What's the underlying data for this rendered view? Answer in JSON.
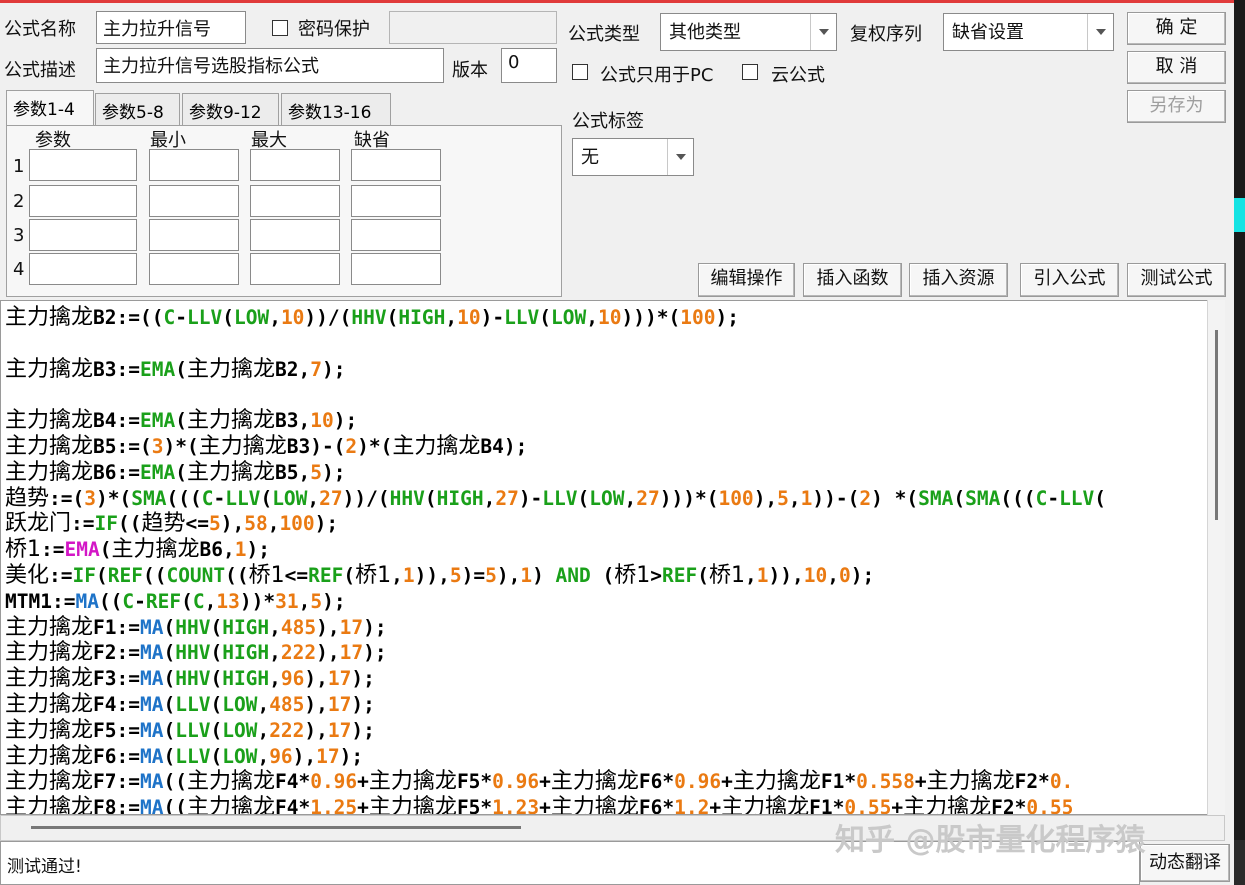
{
  "form": {
    "name_label": "公式名称",
    "name_value": "主力拉升信号",
    "password_label": "密码保护",
    "desc_label": "公式描述",
    "desc_value": "主力拉升信号选股指标公式",
    "version_label": "版本",
    "version_value": "0",
    "type_label": "公式类型",
    "type_value": "其他类型",
    "rights_label": "复权序列",
    "rights_value": "缺省设置",
    "pc_only_label": "公式只用于PC",
    "cloud_label": "云公式",
    "tag_label": "公式标签",
    "tag_value": "无"
  },
  "buttons": {
    "ok": "确 定",
    "cancel": "取 消",
    "save_as": "另存为",
    "edit": "编辑操作",
    "insert_func": "插入函数",
    "insert_res": "插入资源",
    "import": "引入公式",
    "test": "测试公式",
    "translate": "动态翻译"
  },
  "params": {
    "tabs": [
      "参数1-4",
      "参数5-8",
      "参数9-12",
      "参数13-16"
    ],
    "headers": [
      "参数",
      "最小",
      "最大",
      "缺省"
    ],
    "rows": [
      "1",
      "2",
      "3",
      "4"
    ]
  },
  "status": "测试通过!",
  "watermark": "知乎 @股市量化程序猿",
  "colors": {
    "function_green": "#1aa01a",
    "function_blue": "#1e73c8",
    "function_magenta": "#d316c6",
    "number_orange": "#ea7a12"
  },
  "code_lines": [
    [
      [
        "c",
        "主力擒龙"
      ],
      [
        "t",
        "B2:=(("
      ],
      [
        "f",
        "C"
      ],
      [
        "t",
        "-"
      ],
      [
        "f",
        "LLV"
      ],
      [
        "t",
        "("
      ],
      [
        "f",
        "LOW"
      ],
      [
        "t",
        ","
      ],
      [
        "n",
        "10"
      ],
      [
        "t",
        "))/("
      ],
      [
        "f",
        "HHV"
      ],
      [
        "t",
        "("
      ],
      [
        "f",
        "HIGH"
      ],
      [
        "t",
        ","
      ],
      [
        "n",
        "10"
      ],
      [
        "t",
        ")-"
      ],
      [
        "f",
        "LLV"
      ],
      [
        "t",
        "("
      ],
      [
        "f",
        "LOW"
      ],
      [
        "t",
        ","
      ],
      [
        "n",
        "10"
      ],
      [
        "t",
        ")))*("
      ],
      [
        "n",
        "100"
      ],
      [
        "t",
        ");"
      ]
    ],
    [],
    [
      [
        "c",
        "主力擒龙"
      ],
      [
        "t",
        "B3:="
      ],
      [
        "f",
        "EMA"
      ],
      [
        "t",
        "("
      ],
      [
        "c",
        "主力擒龙"
      ],
      [
        "t",
        "B2,"
      ],
      [
        "n",
        "7"
      ],
      [
        "t",
        ");"
      ]
    ],
    [],
    [
      [
        "c",
        "主力擒龙"
      ],
      [
        "t",
        "B4:="
      ],
      [
        "f",
        "EMA"
      ],
      [
        "t",
        "("
      ],
      [
        "c",
        "主力擒龙"
      ],
      [
        "t",
        "B3,"
      ],
      [
        "n",
        "10"
      ],
      [
        "t",
        ");"
      ]
    ],
    [
      [
        "c",
        "主力擒龙"
      ],
      [
        "t",
        "B5:=("
      ],
      [
        "n",
        "3"
      ],
      [
        "t",
        ")*("
      ],
      [
        "c",
        "主力擒龙"
      ],
      [
        "t",
        "B3)-("
      ],
      [
        "n",
        "2"
      ],
      [
        "t",
        ")*("
      ],
      [
        "c",
        "主力擒龙"
      ],
      [
        "t",
        "B4);"
      ]
    ],
    [
      [
        "c",
        "主力擒龙"
      ],
      [
        "t",
        "B6:="
      ],
      [
        "f",
        "EMA"
      ],
      [
        "t",
        "("
      ],
      [
        "c",
        "主力擒龙"
      ],
      [
        "t",
        "B5,"
      ],
      [
        "n",
        "5"
      ],
      [
        "t",
        ");"
      ]
    ],
    [
      [
        "c",
        "趋势"
      ],
      [
        "t",
        ":=("
      ],
      [
        "n",
        "3"
      ],
      [
        "t",
        ")*("
      ],
      [
        "f",
        "SMA"
      ],
      [
        "t",
        "((("
      ],
      [
        "f",
        "C"
      ],
      [
        "t",
        "-"
      ],
      [
        "f",
        "LLV"
      ],
      [
        "t",
        "("
      ],
      [
        "f",
        "LOW"
      ],
      [
        "t",
        ","
      ],
      [
        "n",
        "27"
      ],
      [
        "t",
        "))/("
      ],
      [
        "f",
        "HHV"
      ],
      [
        "t",
        "("
      ],
      [
        "f",
        "HIGH"
      ],
      [
        "t",
        ","
      ],
      [
        "n",
        "27"
      ],
      [
        "t",
        ")-"
      ],
      [
        "f",
        "LLV"
      ],
      [
        "t",
        "("
      ],
      [
        "f",
        "LOW"
      ],
      [
        "t",
        ","
      ],
      [
        "n",
        "27"
      ],
      [
        "t",
        ")))*("
      ],
      [
        "n",
        "100"
      ],
      [
        "t",
        "),"
      ],
      [
        "n",
        "5"
      ],
      [
        "t",
        ","
      ],
      [
        "n",
        "1"
      ],
      [
        "t",
        "))-("
      ],
      [
        "n",
        "2"
      ],
      [
        "t",
        ") *("
      ],
      [
        "f",
        "SMA"
      ],
      [
        "t",
        "("
      ],
      [
        "f",
        "SMA"
      ],
      [
        "t",
        "((("
      ],
      [
        "f",
        "C"
      ],
      [
        "t",
        "-"
      ],
      [
        "f",
        "LLV"
      ],
      [
        "t",
        "("
      ]
    ],
    [
      [
        "c",
        "跃龙门"
      ],
      [
        "t",
        ":="
      ],
      [
        "f",
        "IF"
      ],
      [
        "t",
        "(("
      ],
      [
        "c",
        "趋势"
      ],
      [
        "t",
        "<="
      ],
      [
        "n",
        "5"
      ],
      [
        "t",
        "),"
      ],
      [
        "n",
        "58"
      ],
      [
        "t",
        ","
      ],
      [
        "n",
        "100"
      ],
      [
        "t",
        ");"
      ]
    ],
    [
      [
        "c",
        "桥1"
      ],
      [
        "t",
        ":="
      ],
      [
        "m",
        "EMA"
      ],
      [
        "t",
        "("
      ],
      [
        "c",
        "主力擒龙"
      ],
      [
        "t",
        "B6,"
      ],
      [
        "n",
        "1"
      ],
      [
        "t",
        ");"
      ]
    ],
    [
      [
        "c",
        "美化"
      ],
      [
        "t",
        ":="
      ],
      [
        "f",
        "IF"
      ],
      [
        "t",
        "("
      ],
      [
        "f",
        "REF"
      ],
      [
        "t",
        "(("
      ],
      [
        "f",
        "COUNT"
      ],
      [
        "t",
        "(("
      ],
      [
        "c",
        "桥1"
      ],
      [
        "t",
        "<="
      ],
      [
        "f",
        "REF"
      ],
      [
        "t",
        "("
      ],
      [
        "c",
        "桥1"
      ],
      [
        "t",
        ","
      ],
      [
        "n",
        "1"
      ],
      [
        "t",
        ")),"
      ],
      [
        "n",
        "5"
      ],
      [
        "t",
        ")="
      ],
      [
        "n",
        "5"
      ],
      [
        "t",
        "),"
      ],
      [
        "n",
        "1"
      ],
      [
        "t",
        ") "
      ],
      [
        "f",
        "AND"
      ],
      [
        "t",
        " ("
      ],
      [
        "c",
        "桥1"
      ],
      [
        "t",
        ">"
      ],
      [
        "f",
        "REF"
      ],
      [
        "t",
        "("
      ],
      [
        "c",
        "桥1"
      ],
      [
        "t",
        ","
      ],
      [
        "n",
        "1"
      ],
      [
        "t",
        ")),"
      ],
      [
        "n",
        "10"
      ],
      [
        "t",
        ","
      ],
      [
        "n",
        "0"
      ],
      [
        "t",
        ");"
      ]
    ],
    [
      [
        "t",
        "MTM1:="
      ],
      [
        "b",
        "MA"
      ],
      [
        "t",
        "(("
      ],
      [
        "f",
        "C"
      ],
      [
        "t",
        "-"
      ],
      [
        "f",
        "REF"
      ],
      [
        "t",
        "("
      ],
      [
        "f",
        "C"
      ],
      [
        "t",
        ","
      ],
      [
        "n",
        "13"
      ],
      [
        "t",
        "))*"
      ],
      [
        "n",
        "31"
      ],
      [
        "t",
        ","
      ],
      [
        "n",
        "5"
      ],
      [
        "t",
        ");"
      ]
    ],
    [
      [
        "c",
        "主力擒龙"
      ],
      [
        "t",
        "F1:="
      ],
      [
        "b",
        "MA"
      ],
      [
        "t",
        "("
      ],
      [
        "f",
        "HHV"
      ],
      [
        "t",
        "("
      ],
      [
        "f",
        "HIGH"
      ],
      [
        "t",
        ","
      ],
      [
        "n",
        "485"
      ],
      [
        "t",
        "),"
      ],
      [
        "n",
        "17"
      ],
      [
        "t",
        ");"
      ]
    ],
    [
      [
        "c",
        "主力擒龙"
      ],
      [
        "t",
        "F2:="
      ],
      [
        "b",
        "MA"
      ],
      [
        "t",
        "("
      ],
      [
        "f",
        "HHV"
      ],
      [
        "t",
        "("
      ],
      [
        "f",
        "HIGH"
      ],
      [
        "t",
        ","
      ],
      [
        "n",
        "222"
      ],
      [
        "t",
        "),"
      ],
      [
        "n",
        "17"
      ],
      [
        "t",
        ");"
      ]
    ],
    [
      [
        "c",
        "主力擒龙"
      ],
      [
        "t",
        "F3:="
      ],
      [
        "b",
        "MA"
      ],
      [
        "t",
        "("
      ],
      [
        "f",
        "HHV"
      ],
      [
        "t",
        "("
      ],
      [
        "f",
        "HIGH"
      ],
      [
        "t",
        ","
      ],
      [
        "n",
        "96"
      ],
      [
        "t",
        "),"
      ],
      [
        "n",
        "17"
      ],
      [
        "t",
        ");"
      ]
    ],
    [
      [
        "c",
        "主力擒龙"
      ],
      [
        "t",
        "F4:="
      ],
      [
        "b",
        "MA"
      ],
      [
        "t",
        "("
      ],
      [
        "f",
        "LLV"
      ],
      [
        "t",
        "("
      ],
      [
        "f",
        "LOW"
      ],
      [
        "t",
        ","
      ],
      [
        "n",
        "485"
      ],
      [
        "t",
        "),"
      ],
      [
        "n",
        "17"
      ],
      [
        "t",
        ");"
      ]
    ],
    [
      [
        "c",
        "主力擒龙"
      ],
      [
        "t",
        "F5:="
      ],
      [
        "b",
        "MA"
      ],
      [
        "t",
        "("
      ],
      [
        "f",
        "LLV"
      ],
      [
        "t",
        "("
      ],
      [
        "f",
        "LOW"
      ],
      [
        "t",
        ","
      ],
      [
        "n",
        "222"
      ],
      [
        "t",
        "),"
      ],
      [
        "n",
        "17"
      ],
      [
        "t",
        ");"
      ]
    ],
    [
      [
        "c",
        "主力擒龙"
      ],
      [
        "t",
        "F6:="
      ],
      [
        "b",
        "MA"
      ],
      [
        "t",
        "("
      ],
      [
        "f",
        "LLV"
      ],
      [
        "t",
        "("
      ],
      [
        "f",
        "LOW"
      ],
      [
        "t",
        ","
      ],
      [
        "n",
        "96"
      ],
      [
        "t",
        "),"
      ],
      [
        "n",
        "17"
      ],
      [
        "t",
        ");"
      ]
    ],
    [
      [
        "c",
        "主力擒龙"
      ],
      [
        "t",
        "F7:="
      ],
      [
        "b",
        "MA"
      ],
      [
        "t",
        "(("
      ],
      [
        "c",
        "主力擒龙"
      ],
      [
        "t",
        "F4*"
      ],
      [
        "n",
        "0.96"
      ],
      [
        "t",
        "+"
      ],
      [
        "c",
        "主力擒龙"
      ],
      [
        "t",
        "F5*"
      ],
      [
        "n",
        "0.96"
      ],
      [
        "t",
        "+"
      ],
      [
        "c",
        "主力擒龙"
      ],
      [
        "t",
        "F6*"
      ],
      [
        "n",
        "0.96"
      ],
      [
        "t",
        "+"
      ],
      [
        "c",
        "主力擒龙"
      ],
      [
        "t",
        "F1*"
      ],
      [
        "n",
        "0.558"
      ],
      [
        "t",
        "+"
      ],
      [
        "c",
        "主力擒龙"
      ],
      [
        "t",
        "F2*"
      ],
      [
        "n",
        "0."
      ]
    ],
    [
      [
        "c",
        "主力擒龙"
      ],
      [
        "t",
        "F8:="
      ],
      [
        "b",
        "MA"
      ],
      [
        "t",
        "(("
      ],
      [
        "c",
        "主力擒龙"
      ],
      [
        "t",
        "F4*"
      ],
      [
        "n",
        "1.25"
      ],
      [
        "t",
        "+"
      ],
      [
        "c",
        "主力擒龙"
      ],
      [
        "t",
        "F5*"
      ],
      [
        "n",
        "1.23"
      ],
      [
        "t",
        "+"
      ],
      [
        "c",
        "主力擒龙"
      ],
      [
        "t",
        "F6*"
      ],
      [
        "n",
        "1.2"
      ],
      [
        "t",
        "+"
      ],
      [
        "c",
        "主力擒龙"
      ],
      [
        "t",
        "F1*"
      ],
      [
        "n",
        "0.55"
      ],
      [
        "t",
        "+"
      ],
      [
        "c",
        "主力擒龙"
      ],
      [
        "t",
        "F2*"
      ],
      [
        "n",
        "0.55"
      ]
    ]
  ]
}
